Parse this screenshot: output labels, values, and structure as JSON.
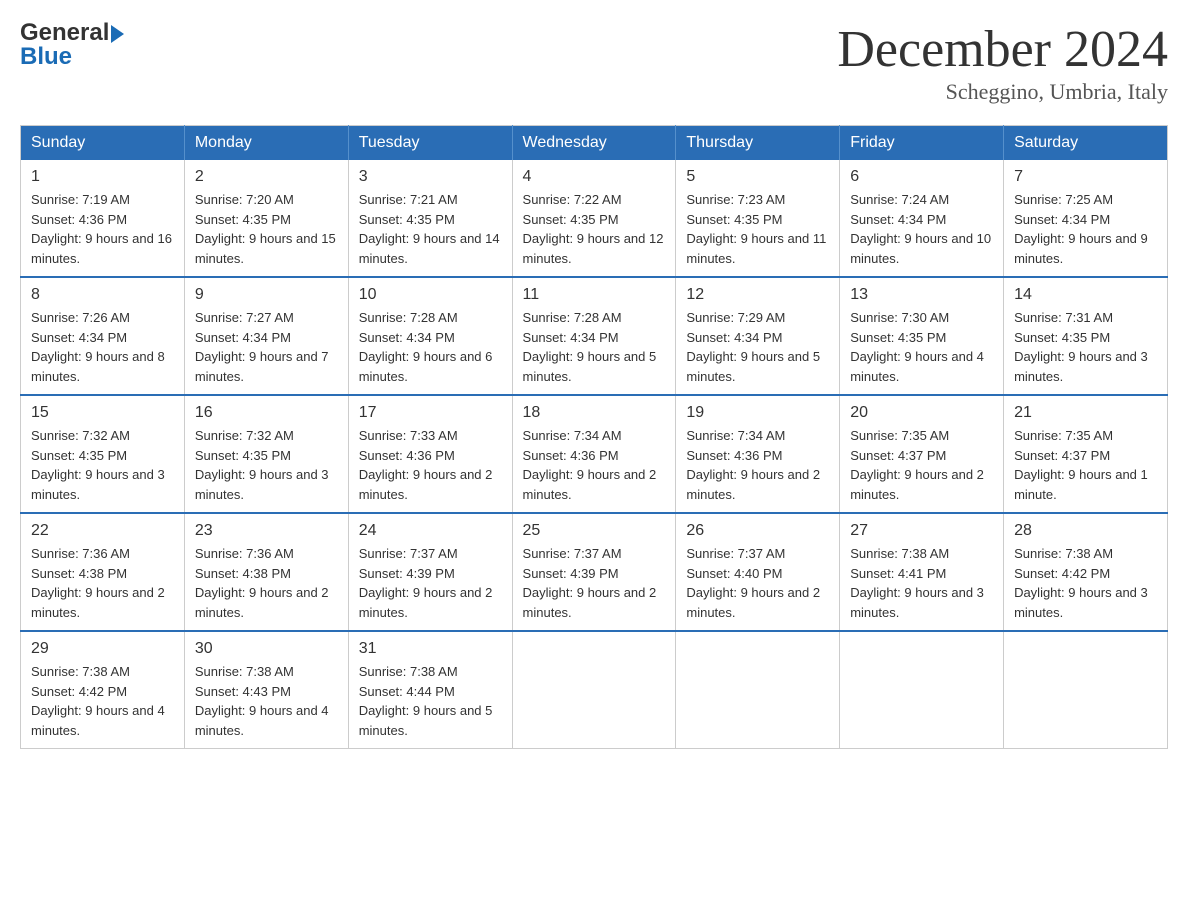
{
  "header": {
    "logo_general": "General",
    "logo_blue": "Blue",
    "month_title": "December 2024",
    "location": "Scheggino, Umbria, Italy"
  },
  "days_of_week": [
    "Sunday",
    "Monday",
    "Tuesday",
    "Wednesday",
    "Thursday",
    "Friday",
    "Saturday"
  ],
  "weeks": [
    [
      {
        "day": "1",
        "sunrise": "Sunrise: 7:19 AM",
        "sunset": "Sunset: 4:36 PM",
        "daylight": "Daylight: 9 hours and 16 minutes."
      },
      {
        "day": "2",
        "sunrise": "Sunrise: 7:20 AM",
        "sunset": "Sunset: 4:35 PM",
        "daylight": "Daylight: 9 hours and 15 minutes."
      },
      {
        "day": "3",
        "sunrise": "Sunrise: 7:21 AM",
        "sunset": "Sunset: 4:35 PM",
        "daylight": "Daylight: 9 hours and 14 minutes."
      },
      {
        "day": "4",
        "sunrise": "Sunrise: 7:22 AM",
        "sunset": "Sunset: 4:35 PM",
        "daylight": "Daylight: 9 hours and 12 minutes."
      },
      {
        "day": "5",
        "sunrise": "Sunrise: 7:23 AM",
        "sunset": "Sunset: 4:35 PM",
        "daylight": "Daylight: 9 hours and 11 minutes."
      },
      {
        "day": "6",
        "sunrise": "Sunrise: 7:24 AM",
        "sunset": "Sunset: 4:34 PM",
        "daylight": "Daylight: 9 hours and 10 minutes."
      },
      {
        "day": "7",
        "sunrise": "Sunrise: 7:25 AM",
        "sunset": "Sunset: 4:34 PM",
        "daylight": "Daylight: 9 hours and 9 minutes."
      }
    ],
    [
      {
        "day": "8",
        "sunrise": "Sunrise: 7:26 AM",
        "sunset": "Sunset: 4:34 PM",
        "daylight": "Daylight: 9 hours and 8 minutes."
      },
      {
        "day": "9",
        "sunrise": "Sunrise: 7:27 AM",
        "sunset": "Sunset: 4:34 PM",
        "daylight": "Daylight: 9 hours and 7 minutes."
      },
      {
        "day": "10",
        "sunrise": "Sunrise: 7:28 AM",
        "sunset": "Sunset: 4:34 PM",
        "daylight": "Daylight: 9 hours and 6 minutes."
      },
      {
        "day": "11",
        "sunrise": "Sunrise: 7:28 AM",
        "sunset": "Sunset: 4:34 PM",
        "daylight": "Daylight: 9 hours and 5 minutes."
      },
      {
        "day": "12",
        "sunrise": "Sunrise: 7:29 AM",
        "sunset": "Sunset: 4:34 PM",
        "daylight": "Daylight: 9 hours and 5 minutes."
      },
      {
        "day": "13",
        "sunrise": "Sunrise: 7:30 AM",
        "sunset": "Sunset: 4:35 PM",
        "daylight": "Daylight: 9 hours and 4 minutes."
      },
      {
        "day": "14",
        "sunrise": "Sunrise: 7:31 AM",
        "sunset": "Sunset: 4:35 PM",
        "daylight": "Daylight: 9 hours and 3 minutes."
      }
    ],
    [
      {
        "day": "15",
        "sunrise": "Sunrise: 7:32 AM",
        "sunset": "Sunset: 4:35 PM",
        "daylight": "Daylight: 9 hours and 3 minutes."
      },
      {
        "day": "16",
        "sunrise": "Sunrise: 7:32 AM",
        "sunset": "Sunset: 4:35 PM",
        "daylight": "Daylight: 9 hours and 3 minutes."
      },
      {
        "day": "17",
        "sunrise": "Sunrise: 7:33 AM",
        "sunset": "Sunset: 4:36 PM",
        "daylight": "Daylight: 9 hours and 2 minutes."
      },
      {
        "day": "18",
        "sunrise": "Sunrise: 7:34 AM",
        "sunset": "Sunset: 4:36 PM",
        "daylight": "Daylight: 9 hours and 2 minutes."
      },
      {
        "day": "19",
        "sunrise": "Sunrise: 7:34 AM",
        "sunset": "Sunset: 4:36 PM",
        "daylight": "Daylight: 9 hours and 2 minutes."
      },
      {
        "day": "20",
        "sunrise": "Sunrise: 7:35 AM",
        "sunset": "Sunset: 4:37 PM",
        "daylight": "Daylight: 9 hours and 2 minutes."
      },
      {
        "day": "21",
        "sunrise": "Sunrise: 7:35 AM",
        "sunset": "Sunset: 4:37 PM",
        "daylight": "Daylight: 9 hours and 1 minute."
      }
    ],
    [
      {
        "day": "22",
        "sunrise": "Sunrise: 7:36 AM",
        "sunset": "Sunset: 4:38 PM",
        "daylight": "Daylight: 9 hours and 2 minutes."
      },
      {
        "day": "23",
        "sunrise": "Sunrise: 7:36 AM",
        "sunset": "Sunset: 4:38 PM",
        "daylight": "Daylight: 9 hours and 2 minutes."
      },
      {
        "day": "24",
        "sunrise": "Sunrise: 7:37 AM",
        "sunset": "Sunset: 4:39 PM",
        "daylight": "Daylight: 9 hours and 2 minutes."
      },
      {
        "day": "25",
        "sunrise": "Sunrise: 7:37 AM",
        "sunset": "Sunset: 4:39 PM",
        "daylight": "Daylight: 9 hours and 2 minutes."
      },
      {
        "day": "26",
        "sunrise": "Sunrise: 7:37 AM",
        "sunset": "Sunset: 4:40 PM",
        "daylight": "Daylight: 9 hours and 2 minutes."
      },
      {
        "day": "27",
        "sunrise": "Sunrise: 7:38 AM",
        "sunset": "Sunset: 4:41 PM",
        "daylight": "Daylight: 9 hours and 3 minutes."
      },
      {
        "day": "28",
        "sunrise": "Sunrise: 7:38 AM",
        "sunset": "Sunset: 4:42 PM",
        "daylight": "Daylight: 9 hours and 3 minutes."
      }
    ],
    [
      {
        "day": "29",
        "sunrise": "Sunrise: 7:38 AM",
        "sunset": "Sunset: 4:42 PM",
        "daylight": "Daylight: 9 hours and 4 minutes."
      },
      {
        "day": "30",
        "sunrise": "Sunrise: 7:38 AM",
        "sunset": "Sunset: 4:43 PM",
        "daylight": "Daylight: 9 hours and 4 minutes."
      },
      {
        "day": "31",
        "sunrise": "Sunrise: 7:38 AM",
        "sunset": "Sunset: 4:44 PM",
        "daylight": "Daylight: 9 hours and 5 minutes."
      },
      null,
      null,
      null,
      null
    ]
  ]
}
